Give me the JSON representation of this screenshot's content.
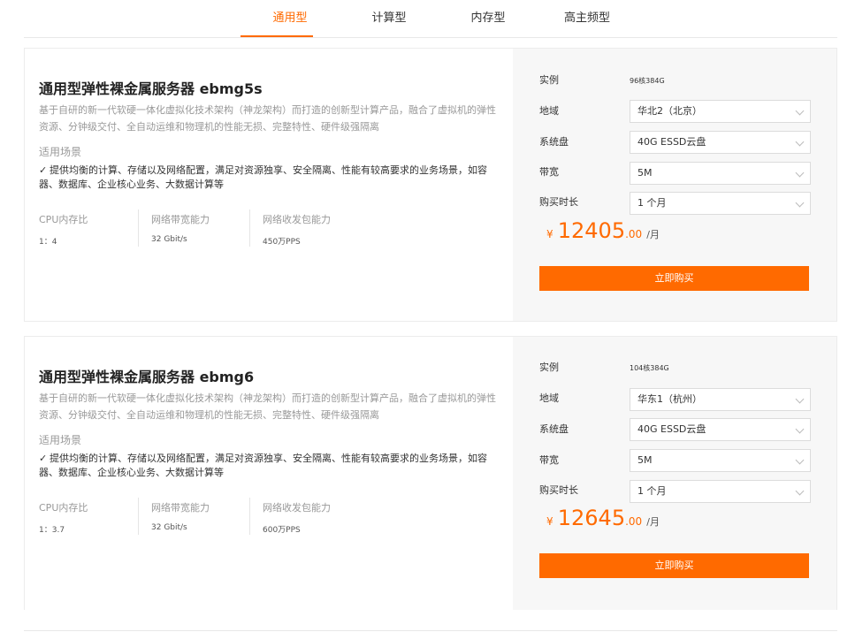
{
  "tabs": [
    {
      "label": "通用型",
      "active": true
    },
    {
      "label": "计算型",
      "active": false
    },
    {
      "label": "内存型",
      "active": false
    },
    {
      "label": "高主频型",
      "active": false
    }
  ],
  "colors": {
    "accent": "#ff6a00",
    "panel_bg": "#f7f7f7"
  },
  "cards": [
    {
      "title": "通用型弹性裸金属服务器 ebmg5s",
      "description": "基于自研的新一代软硬一体化虚拟化技术架构（神龙架构）而打造的创新型计算产品，融合了虚拟机的弹性资源、分钟级交付、全自动运维和物理机的性能无损、完整特性、硬件级强隔离",
      "scene_label": "适用场景",
      "scene_icon": "check-icon",
      "scene_text": "提供均衡的计算、存储以及网络配置，满足对资源独享、安全隔离、性能有较高要求的业务场景，如容器、数据库、企业核心业务、大数据计算等",
      "specs": [
        {
          "label": "CPU内存比",
          "value": "1：4"
        },
        {
          "label": "网络带宽能力",
          "value": "32 Gbit/s"
        },
        {
          "label": "网络收发包能力",
          "value": "450万PPS"
        }
      ],
      "form": {
        "instance_label": "实例",
        "instance_value": "96核384G",
        "region_label": "地域",
        "region_value": "华北2（北京）",
        "disk_label": "系统盘",
        "disk_value": "40G ESSD云盘",
        "bandwidth_label": "带宽",
        "bandwidth_value": "5M",
        "duration_label": "购买时长",
        "duration_value": "1 个月"
      },
      "price": {
        "currency": "¥",
        "integer": "12405",
        "decimal": ".00",
        "unit": "/月"
      },
      "buy_label": "立即购买"
    },
    {
      "title": "通用型弹性裸金属服务器 ebmg6",
      "description": "基于自研的新一代软硬一体化虚拟化技术架构（神龙架构）而打造的创新型计算产品，融合了虚拟机的弹性资源、分钟级交付、全自动运维和物理机的性能无损、完整特性、硬件级强隔离",
      "scene_label": "适用场景",
      "scene_icon": "check-icon",
      "scene_text": "提供均衡的计算、存储以及网络配置，满足对资源独享、安全隔离、性能有较高要求的业务场景，如容器、数据库、企业核心业务、大数据计算等",
      "specs": [
        {
          "label": "CPU内存比",
          "value": "1：3.7"
        },
        {
          "label": "网络带宽能力",
          "value": "32 Gbit/s"
        },
        {
          "label": "网络收发包能力",
          "value": "600万PPS"
        }
      ],
      "form": {
        "instance_label": "实例",
        "instance_value": "104核384G",
        "region_label": "地域",
        "region_value": "华东1（杭州）",
        "disk_label": "系统盘",
        "disk_value": "40G ESSD云盘",
        "bandwidth_label": "带宽",
        "bandwidth_value": "5M",
        "duration_label": "购买时长",
        "duration_value": "1 个月"
      },
      "price": {
        "currency": "¥",
        "integer": "12645",
        "decimal": ".00",
        "unit": "/月"
      },
      "buy_label": "立即购买"
    }
  ]
}
